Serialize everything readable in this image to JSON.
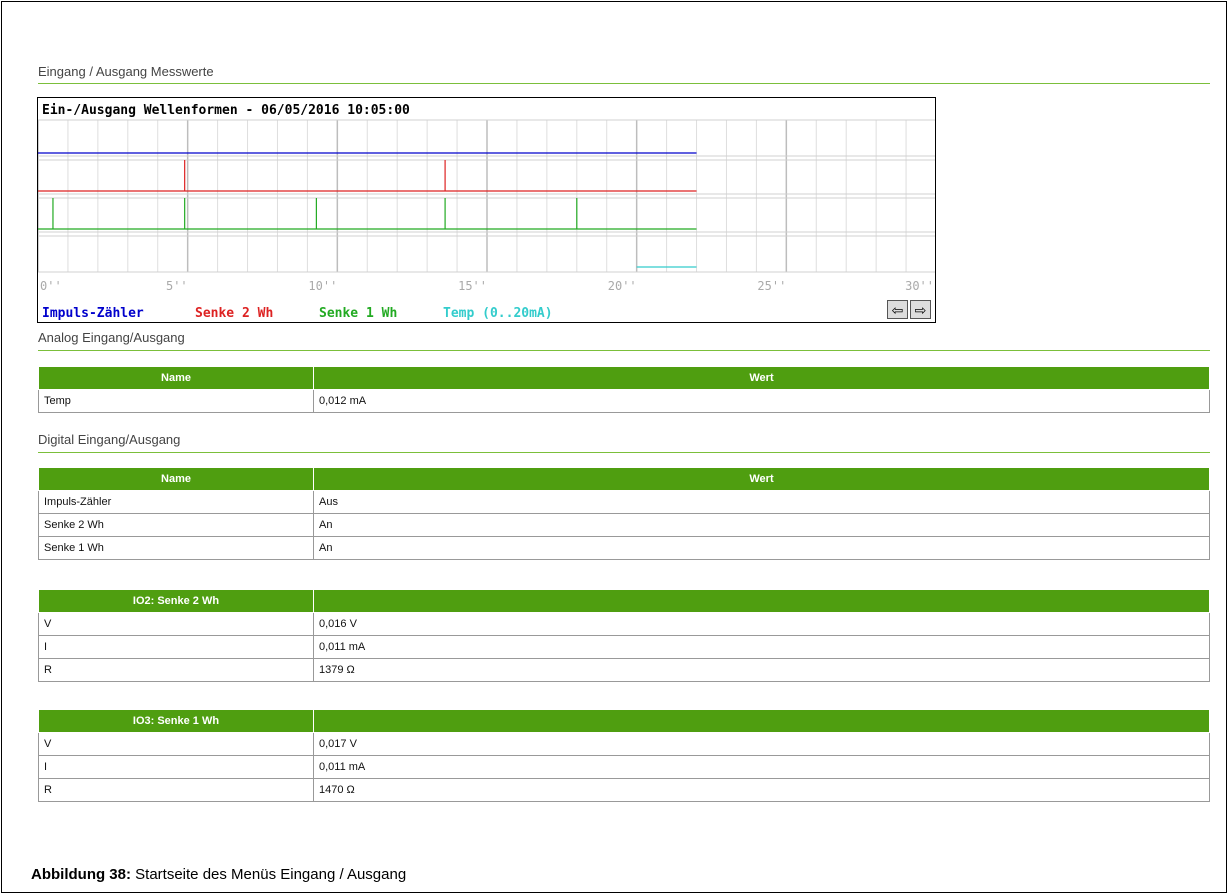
{
  "section_io": "Eingang / Ausgang Messwerte",
  "chart_data": {
    "type": "line",
    "title": "Ein-/Ausgang Wellenformen - 06/05/2016 10:05:00",
    "x_ticks": [
      "0''",
      "5''",
      "10''",
      "15''",
      "20''",
      "25''",
      "30''"
    ],
    "x_range": [
      0,
      30
    ],
    "grid": true,
    "series": [
      {
        "name": "Impuls-Zähler",
        "color": "#0000cc",
        "lane": 0,
        "signal": "constant",
        "x_end": 22,
        "pulses": []
      },
      {
        "name": "Senke 2 Wh",
        "color": "#dd2222",
        "lane": 1,
        "signal": "pulses",
        "x_end": 22,
        "pulses": [
          4.9,
          13.6
        ]
      },
      {
        "name": "Senke 1 Wh",
        "color": "#22aa22",
        "lane": 2,
        "signal": "pulses",
        "x_end": 22,
        "pulses": [
          0.5,
          4.9,
          9.3,
          13.6,
          18.0
        ]
      },
      {
        "name": "Temp (0..20mA)",
        "color": "#33cccc",
        "lane": 3,
        "signal": "level",
        "x_range": [
          20,
          22
        ],
        "value_mA": 0.012
      }
    ],
    "nav": {
      "prev_icon": "arrow-left-icon",
      "next_icon": "arrow-right-icon"
    }
  },
  "analog": {
    "title": "Analog Eingang/Ausgang",
    "headers": [
      "Name",
      "Wert"
    ],
    "rows": [
      [
        "Temp",
        "0,012 mA"
      ]
    ]
  },
  "digital": {
    "title": "Digital Eingang/Ausgang",
    "headers": [
      "Name",
      "Wert"
    ],
    "rows": [
      [
        "Impuls-Zähler",
        "Aus"
      ],
      [
        "Senke 2 Wh",
        "An"
      ],
      [
        "Senke 1 Wh",
        "An"
      ]
    ]
  },
  "io2": {
    "header": "IO2: Senke 2 Wh",
    "rows": [
      [
        "V",
        "0,016 V"
      ],
      [
        "I",
        "0,011 mA"
      ],
      [
        "R",
        "1379 Ω"
      ]
    ]
  },
  "io3": {
    "header": "IO3: Senke 1 Wh",
    "rows": [
      [
        "V",
        "0,017 V"
      ],
      [
        "I",
        "0,011 mA"
      ],
      [
        "R",
        "1470 Ω"
      ]
    ]
  },
  "caption": {
    "label": "Abbildung 38:",
    "text": " Startseite des Menüs Eingang / Ausgang"
  },
  "colors": {
    "accent_green": "#4f9e10",
    "rule_green": "#7bbf3a"
  }
}
